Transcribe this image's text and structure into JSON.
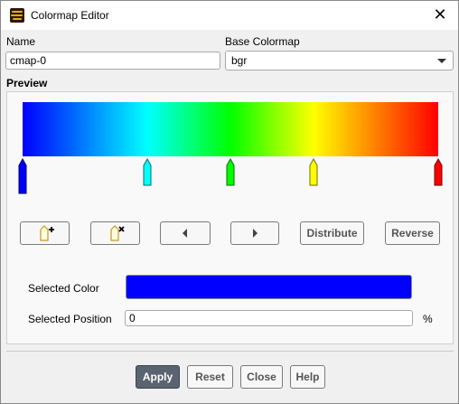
{
  "window": {
    "title": "Colormap Editor"
  },
  "name_field": {
    "label": "Name",
    "value": "cmap-0"
  },
  "base_colormap": {
    "label": "Base Colormap",
    "value": "bgr"
  },
  "preview": {
    "label": "Preview",
    "stops": [
      {
        "position": 0,
        "color": "#0000ff"
      },
      {
        "position": 0.3,
        "color": "#00ffff"
      },
      {
        "position": 0.5,
        "color": "#00ff00"
      },
      {
        "position": 0.7,
        "color": "#ffff00"
      },
      {
        "position": 1.0,
        "color": "#ff0000"
      }
    ]
  },
  "toolbar": {
    "add_icon": "add-stop-icon",
    "delete_icon": "delete-stop-icon",
    "prev_icon": "arrow-left-icon",
    "next_icon": "arrow-right-icon",
    "distribute_label": "Distribute",
    "reverse_label": "Reverse"
  },
  "selected": {
    "color_label": "Selected Color",
    "color_value": "#0000ff",
    "position_label": "Selected Position",
    "position_value": "0",
    "position_unit": "%"
  },
  "footer": {
    "apply_label": "Apply",
    "reset_label": "Reset",
    "close_label": "Close",
    "help_label": "Help"
  }
}
